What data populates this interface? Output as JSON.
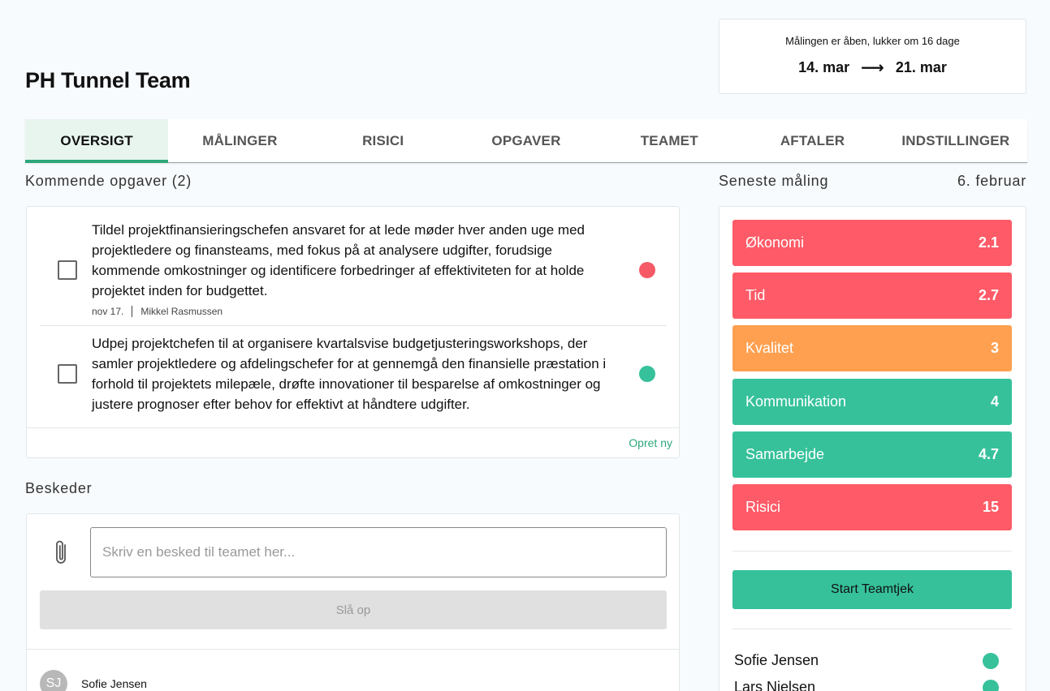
{
  "team": {
    "title": "PH Tunnel Team"
  },
  "period": {
    "status": "Målingen er åben, lukker om 16 dage",
    "start": "14. mar",
    "arrow": "⟶",
    "end": "21. mar"
  },
  "tabs": [
    {
      "label": "OVERSIGT",
      "active": true
    },
    {
      "label": "MÅLINGER"
    },
    {
      "label": "RISICI"
    },
    {
      "label": "OPGAVER"
    },
    {
      "label": "TEAMET"
    },
    {
      "label": "AFTALER"
    },
    {
      "label": "INDSTILLINGER"
    }
  ],
  "tasks": {
    "heading": "Kommende opgaver (2)",
    "items": [
      {
        "text": "Tildel projektfinansieringschefen ansvaret for at lede møder hver anden uge med projektledere og finansteams, med fokus på at analysere udgifter, forudsige kommende omkostninger og identificere forbedringer af effektiviteten for at holde projektet inden for budgettet.",
        "date": "nov 17.",
        "assignee": "Mikkel Rasmussen",
        "status_color": "#f55a66"
      },
      {
        "text": "Udpej projektchefen til at organisere kvartalsvise budgetjusteringsworkshops, der samler projektledere og afdelingschefer for at gennemgå den finansielle præstation i forhold til projektets milepæle, drøfte innovationer til besparelse af omkostninger og justere prognoser efter behov for effektivt at håndtere udgifter.",
        "status_color": "#36c19b"
      }
    ],
    "create_label": "Opret ny"
  },
  "messages": {
    "heading": "Beskeder",
    "placeholder": "Skriv en besked til teamet her...",
    "submit_label": "Slå op",
    "latest": {
      "initials": "SJ",
      "author": "Sofie Jensen"
    }
  },
  "latest_measurement": {
    "heading": "Seneste måling",
    "date": "6. februar",
    "scores": [
      {
        "label": "Økonomi",
        "value": "2.1",
        "color": "#ff5a67"
      },
      {
        "label": "Tid",
        "value": "2.7",
        "color": "#ff5a67"
      },
      {
        "label": "Kvalitet",
        "value": "3",
        "color": "#ffa050"
      },
      {
        "label": "Kommunikation",
        "value": "4",
        "color": "#36c19b"
      },
      {
        "label": "Samarbejde",
        "value": "4.7",
        "color": "#36c19b"
      },
      {
        "label": "Risici",
        "value": "15",
        "color": "#ff5a67"
      }
    ],
    "start_button": "Start Teamtjek",
    "members": [
      {
        "name": "Sofie Jensen",
        "color": "#36c19b"
      },
      {
        "name": "Lars Nielsen",
        "color": "#36c19b"
      }
    ]
  }
}
